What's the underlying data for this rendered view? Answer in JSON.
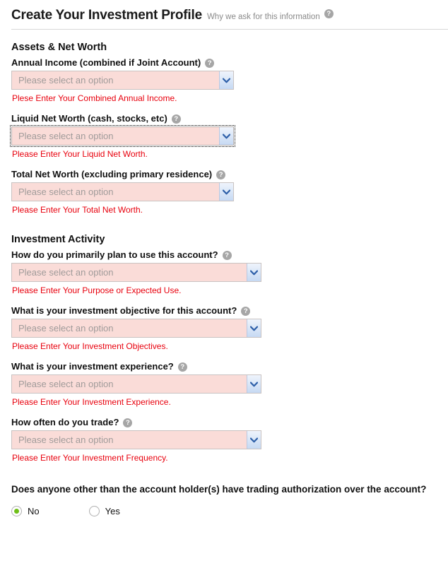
{
  "header": {
    "title": "Create Your Investment Profile",
    "subtitle": "Why we ask for this information",
    "help_icon": "help-circle-icon"
  },
  "sections": [
    {
      "heading": "Assets & Net Worth",
      "fields": [
        {
          "label": "Annual Income (combined if Joint Account)",
          "placeholder": "Please select an option",
          "error": "Plese Enter Your Combined Annual Income.",
          "width": "narrow",
          "focused": false
        },
        {
          "label": "Liquid Net Worth (cash, stocks, etc)",
          "placeholder": "Please select an option",
          "error": "Please Enter Your Liquid Net Worth.",
          "width": "narrow",
          "focused": true
        },
        {
          "label": "Total Net Worth (excluding primary residence)",
          "placeholder": "Please select an option",
          "error": "Please Enter Your Total Net Worth.",
          "width": "narrow",
          "focused": false
        }
      ]
    },
    {
      "heading": "Investment Activity",
      "fields": [
        {
          "label": "How do you primarily plan to use this account?",
          "placeholder": "Please select an option",
          "error": "Please Enter Your Purpose or Expected Use.",
          "width": "wide",
          "focused": false
        },
        {
          "label": "What is your investment objective for this account?",
          "placeholder": "Please select an option",
          "error": "Please Enter Your Investment Objectives.",
          "width": "wide",
          "focused": false
        },
        {
          "label": "What is your investment experience?",
          "placeholder": "Please select an option",
          "error": "Please Enter Your Investment Experience.",
          "width": "wide",
          "focused": false
        },
        {
          "label": "How often do you trade?",
          "placeholder": "Please select an option",
          "error": "Please Enter Your Investment Frequency.",
          "width": "wide",
          "focused": false
        }
      ]
    }
  ],
  "trading_authorization": {
    "question": "Does anyone other than the account holder(s) have trading authorization over the account?",
    "options": [
      {
        "label": "No",
        "checked": true
      },
      {
        "label": "Yes",
        "checked": false
      }
    ]
  },
  "colors": {
    "error_red": "#e8000d",
    "invalid_field_bg": "#fadcd8",
    "radio_selected": "#6fbf18",
    "help_icon_gray": "#a6a6a6"
  }
}
